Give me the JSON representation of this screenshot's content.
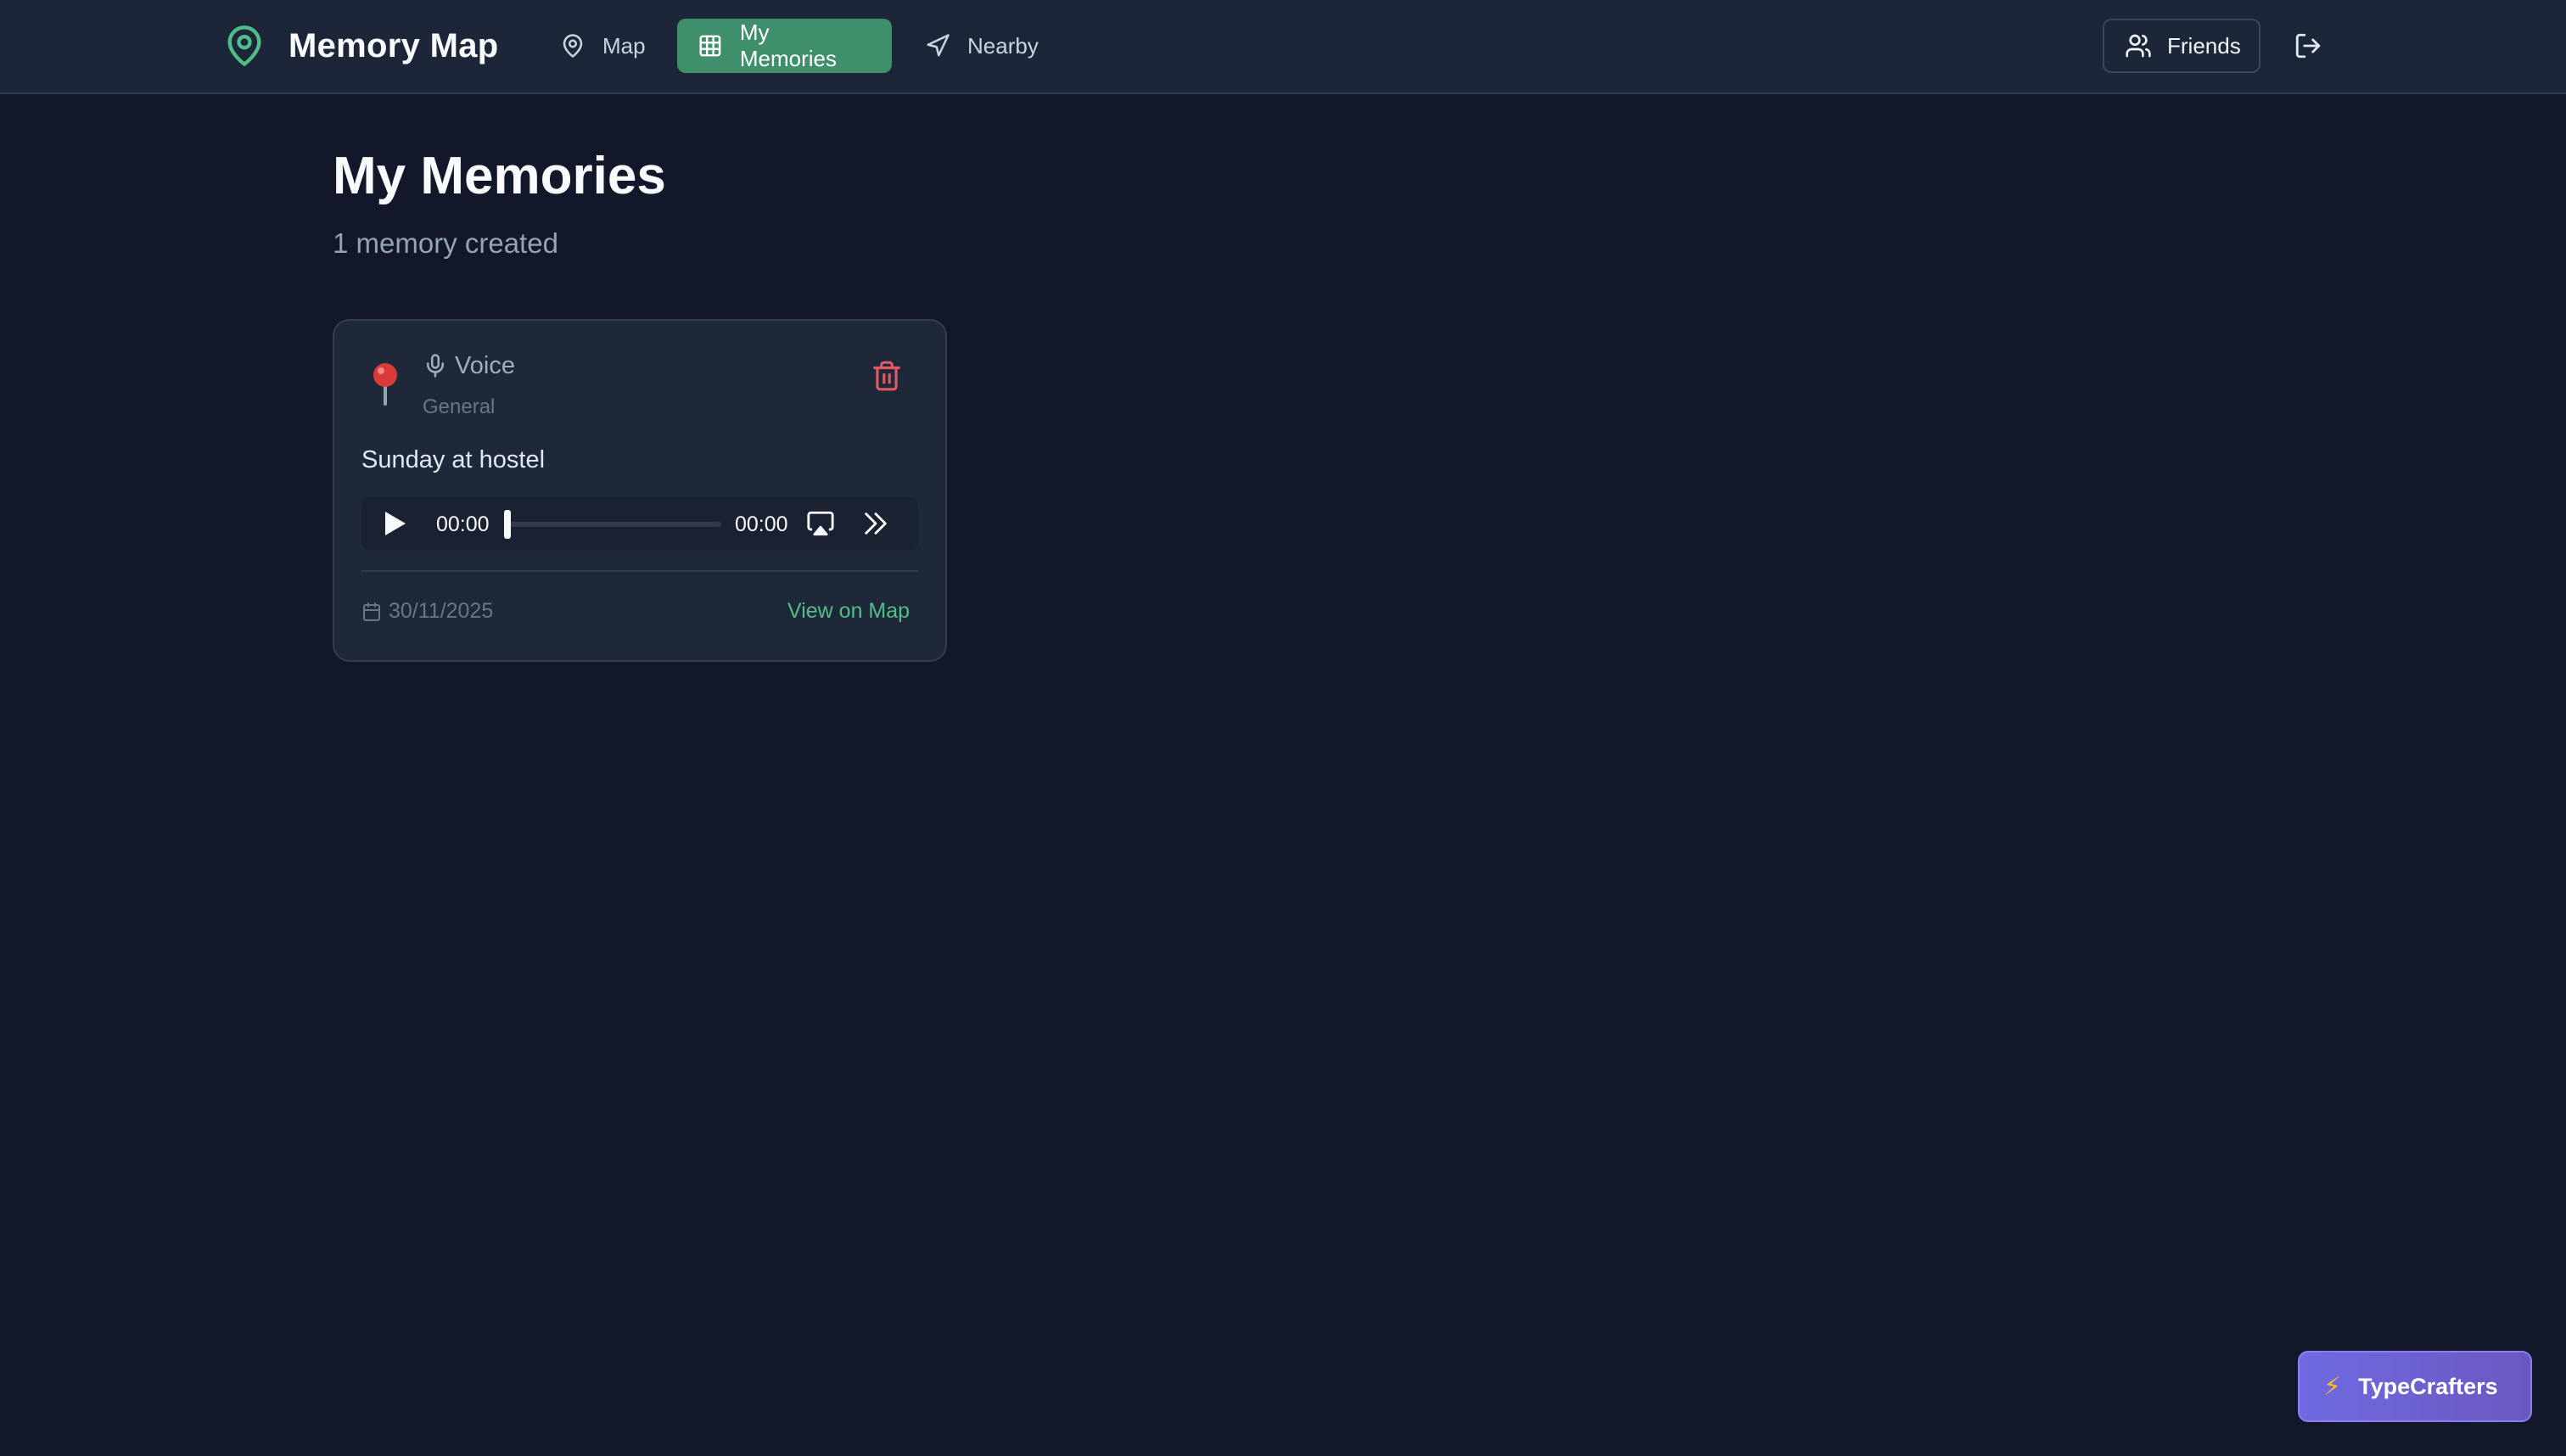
{
  "app": {
    "title": "Memory Map",
    "accent_color": "#3f8f6a",
    "logo_icon": "map-pin-icon"
  },
  "nav": {
    "items": [
      {
        "label": "Map",
        "icon": "map-pin-icon",
        "active": false
      },
      {
        "label": "My Memories",
        "icon": "grid-icon",
        "active": true
      },
      {
        "label": "Nearby",
        "icon": "navigation-arrow-icon",
        "active": false
      }
    ],
    "friends_label": "Friends",
    "friends_icon": "users-icon",
    "logout_icon": "logout-icon"
  },
  "page": {
    "title": "My Memories",
    "subtitle": "1 memory created"
  },
  "memories": [
    {
      "type_label": "Voice",
      "type_icon": "microphone-icon",
      "category": "General",
      "text": "Sunday at hostel",
      "audio": {
        "current_time": "00:00",
        "duration": "00:00",
        "progress": 0
      },
      "date": "30/11/2025",
      "view_map_label": "View on Map",
      "pin_icon": "pushpin-icon",
      "delete_icon": "trash-icon",
      "delete_color": "#e05a65",
      "link_color": "#4fbf87"
    }
  ],
  "badge": {
    "label": "TypeCrafters",
    "icon": "lightning-icon"
  }
}
